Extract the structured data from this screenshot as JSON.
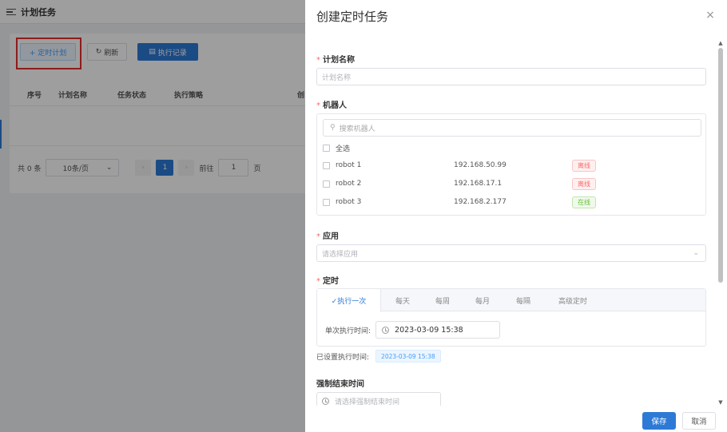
{
  "background": {
    "title": "计划任务",
    "buttons": {
      "plan": "+ 定时计划",
      "refresh": "刷新",
      "record": "执行记录"
    },
    "columns": [
      "序号",
      "计划名称",
      "任务状态",
      "执行策略",
      "创"
    ],
    "pager": {
      "total": "共 0 条",
      "page_size": "10条/页",
      "current_page": "1",
      "goto_prefix": "前往",
      "goto_value": "1",
      "goto_suffix": "页"
    }
  },
  "drawer": {
    "title": "创建定时任务",
    "close": "×",
    "plan_name": {
      "label": "计划名称",
      "placeholder": "计划名称"
    },
    "robot": {
      "label": "机器人",
      "search_placeholder": "搜索机器人",
      "select_all": "全选",
      "items": [
        {
          "name": "robot 1",
          "ip": "192.168.50.99",
          "status": "离线",
          "status_type": "offline"
        },
        {
          "name": "robot 2",
          "ip": "192.168.17.1",
          "status": "离线",
          "status_type": "offline"
        },
        {
          "name": "robot 3",
          "ip": "192.168.2.177",
          "status": "在线",
          "status_type": "online"
        }
      ]
    },
    "app": {
      "label": "应用",
      "placeholder": "请选择应用"
    },
    "timer": {
      "label": "定时",
      "tabs": [
        "✓执行一次",
        "每天",
        "每周",
        "每月",
        "每隔",
        "高级定时"
      ],
      "active_tab": 0,
      "single_time_label": "单次执行时间:",
      "single_time_value": "2023-03-09 15:38"
    },
    "set_time": {
      "label": "已设置执行时间:",
      "value": "2023-03-09 15:38"
    },
    "force_end": {
      "label": "强制结束时间",
      "placeholder": "请选择强制结束时间"
    },
    "footer": {
      "save": "保存",
      "cancel": "取消"
    }
  },
  "colors": {
    "primary": "#2d7ad6",
    "danger": "#f56c6c",
    "success": "#67c23a",
    "highlight": "#e52e2e"
  }
}
